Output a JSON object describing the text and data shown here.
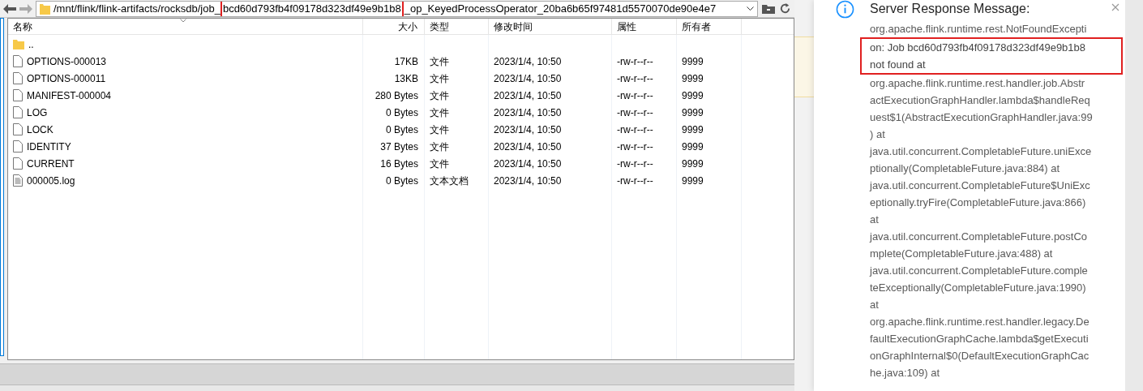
{
  "file_manager": {
    "path_prefix": "/mnt/flink/flink-artifacts/rocksdb/job_",
    "path_highlight": "bcd60d793fb4f09178d323df49e9b1b8",
    "path_suffix": "_op_KeyedProcessOperator_20ba6b65f97481d5570070de90e4e7",
    "columns": [
      "名称",
      "大小",
      "类型",
      "修改时间",
      "属性",
      "所有者"
    ],
    "rows": [
      {
        "kind": "folder",
        "name": "..",
        "size": "",
        "type": "",
        "modified": "",
        "attributes": "",
        "owner": ""
      },
      {
        "kind": "file",
        "name": "OPTIONS-000013",
        "size": "17KB",
        "type": "文件",
        "modified": "2023/1/4, 10:50",
        "attributes": "-rw-r--r--",
        "owner": "9999"
      },
      {
        "kind": "file",
        "name": "OPTIONS-000011",
        "size": "13KB",
        "type": "文件",
        "modified": "2023/1/4, 10:50",
        "attributes": "-rw-r--r--",
        "owner": "9999"
      },
      {
        "kind": "file",
        "name": "MANIFEST-000004",
        "size": "280 Bytes",
        "type": "文件",
        "modified": "2023/1/4, 10:50",
        "attributes": "-rw-r--r--",
        "owner": "9999"
      },
      {
        "kind": "file",
        "name": "LOG",
        "size": "0 Bytes",
        "type": "文件",
        "modified": "2023/1/4, 10:50",
        "attributes": "-rw-r--r--",
        "owner": "9999"
      },
      {
        "kind": "file",
        "name": "LOCK",
        "size": "0 Bytes",
        "type": "文件",
        "modified": "2023/1/4, 10:50",
        "attributes": "-rw-r--r--",
        "owner": "9999"
      },
      {
        "kind": "file",
        "name": "IDENTITY",
        "size": "37 Bytes",
        "type": "文件",
        "modified": "2023/1/4, 10:50",
        "attributes": "-rw-r--r--",
        "owner": "9999"
      },
      {
        "kind": "file",
        "name": "CURRENT",
        "size": "16 Bytes",
        "type": "文件",
        "modified": "2023/1/4, 10:50",
        "attributes": "-rw-r--r--",
        "owner": "9999"
      },
      {
        "kind": "text",
        "name": "000005.log",
        "size": "0 Bytes",
        "type": "文本文档",
        "modified": "2023/1/4, 10:50",
        "attributes": "-rw-r--r--",
        "owner": "9999"
      }
    ]
  },
  "notification": {
    "title": "Server Response Message:",
    "lines": [
      {
        "text": "org.apache.flink.runtime.rest.NotFoundExcepti",
        "highlighted": false
      },
      {
        "text": "on: Job bcd60d793fb4f09178d323df49e9b1b8",
        "highlighted": true
      },
      {
        "text": "not found at",
        "highlighted": true
      },
      {
        "text": "org.apache.flink.runtime.rest.handler.job.Abstr",
        "highlighted": false
      },
      {
        "text": "actExecutionGraphHandler.lambda$handleReq",
        "highlighted": false
      },
      {
        "text": "uest$1(AbstractExecutionGraphHandler.java:99",
        "highlighted": false
      },
      {
        "text": ") at",
        "highlighted": false
      },
      {
        "text": "java.util.concurrent.CompletableFuture.uniExce",
        "highlighted": false
      },
      {
        "text": "ptionally(CompletableFuture.java:884) at",
        "highlighted": false
      },
      {
        "text": "java.util.concurrent.CompletableFuture$UniExc",
        "highlighted": false
      },
      {
        "text": "eptionally.tryFire(CompletableFuture.java:866)",
        "highlighted": false
      },
      {
        "text": "at",
        "highlighted": false
      },
      {
        "text": "java.util.concurrent.CompletableFuture.postCo",
        "highlighted": false
      },
      {
        "text": "mplete(CompletableFuture.java:488) at",
        "highlighted": false
      },
      {
        "text": "java.util.concurrent.CompletableFuture.comple",
        "highlighted": false
      },
      {
        "text": "teExceptionally(CompletableFuture.java:1990)",
        "highlighted": false
      },
      {
        "text": "at",
        "highlighted": false
      },
      {
        "text": "org.apache.flink.runtime.rest.handler.legacy.De",
        "highlighted": false
      },
      {
        "text": "faultExecutionGraphCache.lambda$getExecuti",
        "highlighted": false
      },
      {
        "text": "onGraphInternal$0(DefaultExecutionGraphCac",
        "highlighted": false
      },
      {
        "text": "he.java:109) at",
        "highlighted": false
      }
    ]
  }
}
